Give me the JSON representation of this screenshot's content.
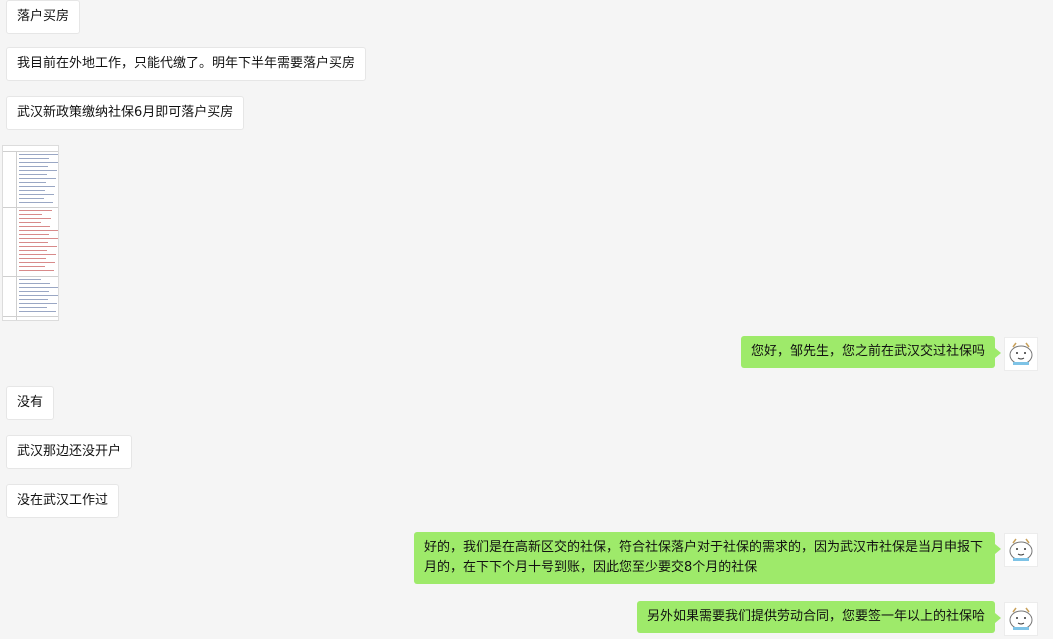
{
  "messages": [
    {
      "side": "left",
      "text": "落户买房"
    },
    {
      "side": "left",
      "text": "我目前在外地工作，只能代缴了。明年下半年需要落户买房"
    },
    {
      "side": "left",
      "text": "武汉新政策缴纳社保6月即可落户买房"
    },
    {
      "side": "left",
      "type": "image"
    },
    {
      "side": "right",
      "text": "您好，邹先生，您之前在武汉交过社保吗"
    },
    {
      "side": "left",
      "text": "没有"
    },
    {
      "side": "left",
      "text": "武汉那边还没开户"
    },
    {
      "side": "left",
      "text": "没在武汉工作过"
    },
    {
      "side": "right",
      "text": "好的，我们是在高新区交的社保，符合社保落户对于社保的需求的，因为武汉市社保是当月申报下月的，在下下个月十号到账，因此您至少要交8个月的社保"
    },
    {
      "side": "right",
      "text": "另外如果需要我们提供劳动合同，您要签一年以上的社保哈"
    }
  ],
  "colors": {
    "background": "#f5f5f5",
    "left_bubble": "#ffffff",
    "right_bubble": "#9eea6a"
  },
  "icons": {
    "agent_avatar": "cartoon-avatar-icon"
  }
}
